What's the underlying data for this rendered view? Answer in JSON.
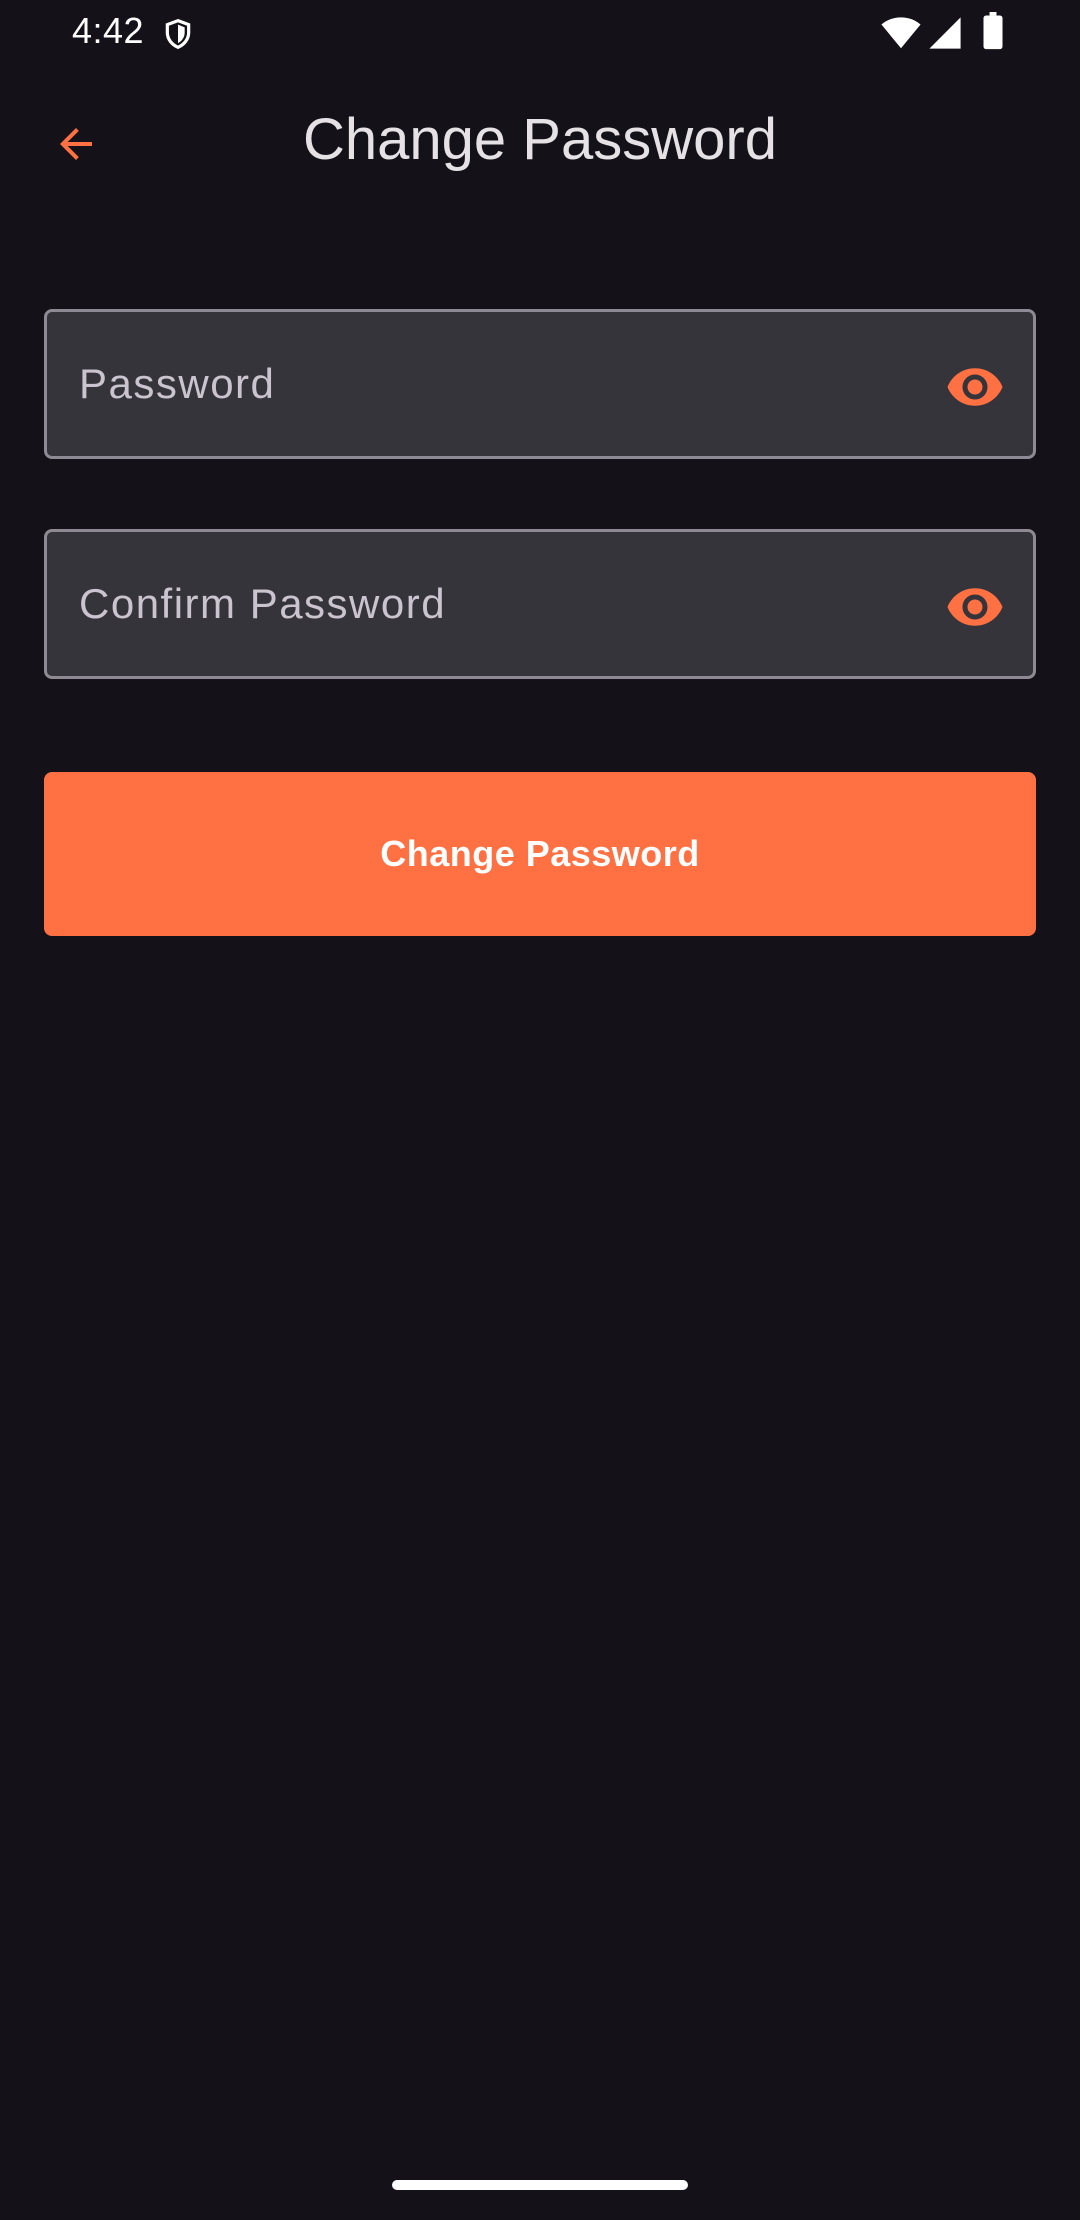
{
  "status_bar": {
    "time": "4:42",
    "icons": [
      "shield-icon",
      "wifi-icon",
      "cellular-signal-icon",
      "battery-icon"
    ]
  },
  "app_bar": {
    "title": "Change Password",
    "back_icon": "arrow-back-icon"
  },
  "form": {
    "password": {
      "placeholder": "Password",
      "value": "",
      "toggle_icon": "eye-icon"
    },
    "confirm_password": {
      "placeholder": "Confirm Password",
      "value": "",
      "toggle_icon": "eye-icon"
    },
    "submit_label": "Change Password"
  },
  "colors": {
    "background": "#141218",
    "accent": "#ff7043",
    "field_background": "#36343b",
    "field_border": "#8e8a93",
    "text_primary": "#e6e1e5",
    "placeholder": "#cac4cf"
  }
}
